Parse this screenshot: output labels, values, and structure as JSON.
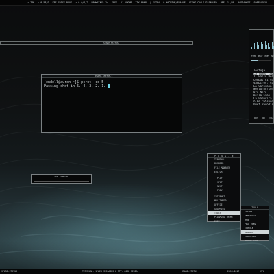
{
  "topbar": {
    "items": [
      "↑ 74K",
      "↓ 0.58/0",
      "KBS GRISE ROUE",
      "↑ 0.0/1/2",
      "BROWSING: 1x",
      "FREE",
      "/1-/HOME",
      "TTY:0068",
      "| EXTRA",
      "0 MACHINE/ENABLE",
      "LIGHT CYCLE DISABLED",
      "HPE: 1 /AP",
      "RADIANCES",
      "SOBERLOYAL"
    ]
  },
  "longbar": {
    "label": "SPARE-STATUS"
  },
  "terminal": {
    "title": "PANEL·STATUS·1",
    "lines": [
      "[endell@auron ~]$ pcrot -cd 5",
      "Passing shot in 5.  4.  3.  2.  1."
    ]
  },
  "music": {
    "controls": [
      "TEMP",
      "PLAY",
      "PREV",
      "NEXT"
    ],
    "progress": 0.35,
    "tracks": [
      "Tortuga",
      "La Tumba Improvisada",
      "Il Passo Del Ricordo",
      "Combat Circonspection",
      "Vampiros: Cuirasse",
      "La Carovana",
      "Nocturnorkonen",
      "Oro Nero",
      "Bella Ciao",
      "La Fabbrica Del Mosto",
      "A La Patchanka",
      "Duet Parodistico"
    ],
    "active_index": 1,
    "footer": [
      "REP",
      "RND",
      "VOL"
    ]
  },
  "inputbox": {
    "label": "RUN COMMAND"
  },
  "menu": {
    "title": "P L U G I N",
    "items": [
      {
        "label": "TERMINAL",
        "sub": false
      },
      {
        "label": "BROWSER",
        "sub": false
      },
      {
        "label": "FILE MANAGER",
        "sub": false
      },
      {
        "label": "EDITOR",
        "sub": false
      },
      {
        "label": "GAP",
        "sub": false
      },
      {
        "label": "PLAY",
        "sub": true
      },
      {
        "label": "STOP",
        "sub": true
      },
      {
        "label": "NEXT",
        "sub": true
      },
      {
        "label": "PREV",
        "sub": true
      },
      {
        "label": "GAP",
        "sub": false
      },
      {
        "label": "INTERNET",
        "sub": false
      },
      {
        "label": "MULTIMEDIA",
        "sub": false
      },
      {
        "label": "OFFICE",
        "sub": false
      },
      {
        "label": "GRAPHICS",
        "sub": false
      },
      {
        "label": "TOOLS",
        "sub": false,
        "highlight": true
      },
      {
        "label": "PLASMOID THEME",
        "sub": false
      },
      {
        "label": "EXIT",
        "sub": false
      }
    ]
  },
  "submenu": {
    "title": "TOOLS",
    "items": [
      {
        "label": "SYSTEM"
      },
      {
        "label": "TERMINALS"
      },
      {
        "label": "HTOP"
      },
      {
        "label": "FILE VIEW"
      },
      {
        "label": "CONSOLE"
      },
      {
        "label": "DROPBOX",
        "highlight": true
      },
      {
        "label": "PARCHEMIN"
      },
      {
        "label": "BACKUP TOOL"
      }
    ]
  },
  "taskbar": {
    "left": "SPARE-STATUS",
    "center": "TERMINAL: 1/WEB  MESSAGES 0  TTY: 0068 MEDIA",
    "right1": "SPARE-STATUS",
    "right2": "2016-2017",
    "right3": "CPU"
  }
}
